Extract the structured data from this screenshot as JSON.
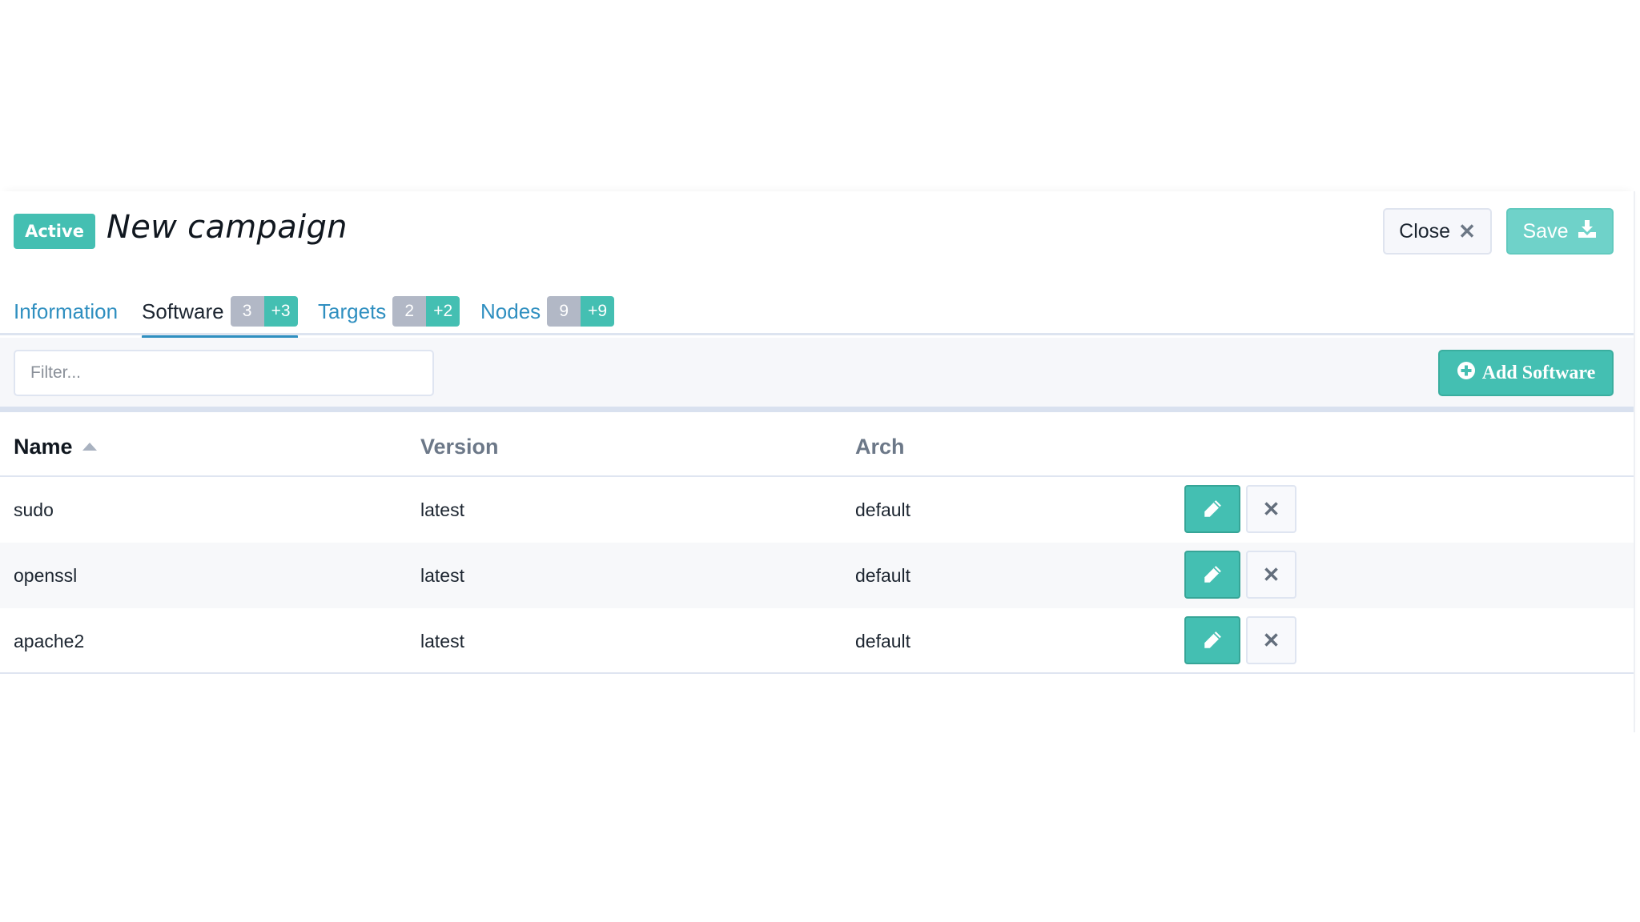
{
  "header": {
    "status": "Active",
    "title": "New campaign",
    "close_label": "Close",
    "save_label": "Save"
  },
  "tabs": [
    {
      "label": "Information",
      "active": false
    },
    {
      "label": "Software",
      "active": true,
      "count": "3",
      "added": "+3"
    },
    {
      "label": "Targets",
      "active": false,
      "count": "2",
      "added": "+2"
    },
    {
      "label": "Nodes",
      "active": false,
      "count": "9",
      "added": "+9"
    }
  ],
  "filter": {
    "placeholder": "Filter...",
    "value": ""
  },
  "add_button_label": "Add Software",
  "table": {
    "columns": [
      "Name",
      "Version",
      "Arch"
    ],
    "sort": {
      "column": "Name",
      "direction": "asc"
    },
    "rows": [
      {
        "name": "sudo",
        "version": "latest",
        "arch": "default"
      },
      {
        "name": "openssl",
        "version": "latest",
        "arch": "default"
      },
      {
        "name": "apache2",
        "version": "latest",
        "arch": "default"
      }
    ]
  },
  "colors": {
    "accent": "#44bfb2",
    "link": "#2f8fc0",
    "count_gray": "#b2b8c6"
  }
}
